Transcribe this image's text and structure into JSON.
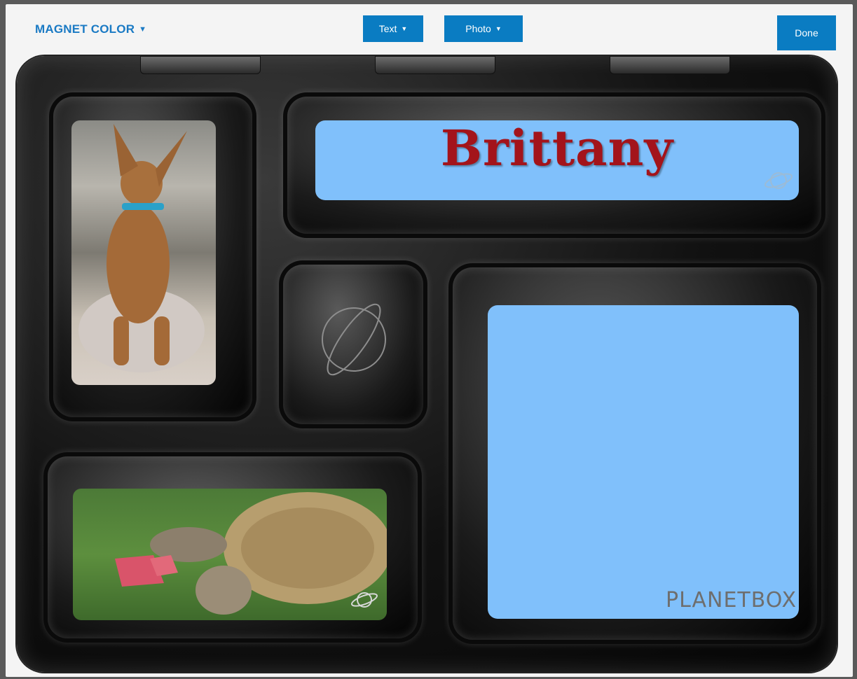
{
  "toolbar": {
    "magnet_color_label": "MAGNET COLOR",
    "text_button_label": "Text",
    "photo_button_label": "Photo",
    "done_button_label": "Done"
  },
  "magnet": {
    "name_text": "Brittany",
    "brand_logo": "PLANETBOX",
    "panel_color": "#80c0fb",
    "text_color": "#a3141b"
  },
  "photos": {
    "left_top": "dog photo",
    "left_bottom": "tortoise photo"
  },
  "colors": {
    "accent": "#0a7cc2",
    "link": "#1a7ac4"
  }
}
